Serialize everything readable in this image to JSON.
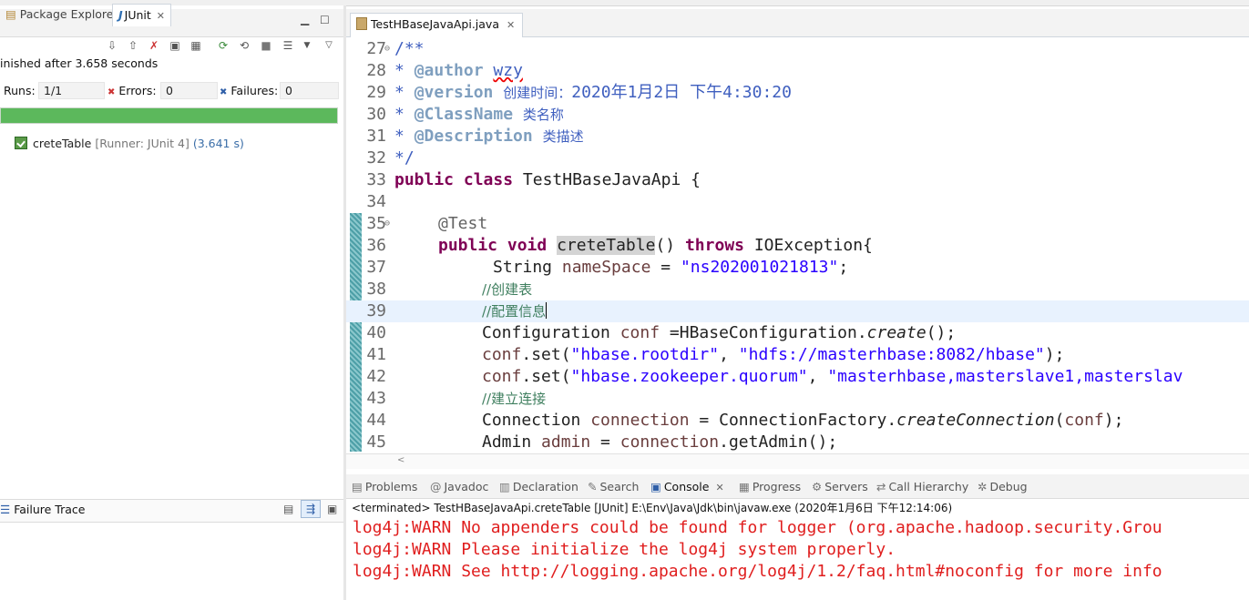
{
  "left_panel": {
    "tabs": [
      {
        "label": "Package Explorer"
      },
      {
        "label": "JUnit"
      }
    ],
    "status": "inished after 3.658 seconds",
    "runs_label": "Runs:",
    "runs_value": "1/1",
    "errors_label": "Errors:",
    "errors_value": "0",
    "failures_label": "Failures:",
    "failures_value": "0",
    "progress": 1.0,
    "progress_color": "#5cb85c",
    "test": {
      "name": "creteTable",
      "runner": "[Runner: JUnit 4]",
      "time": "(3.641 s)"
    },
    "failure_trace_label": "Failure Trace"
  },
  "editor": {
    "tab_label": "TestHBaseJavaApi.java",
    "line_numbers": [
      "27",
      "28",
      "29",
      "30",
      "31",
      "32",
      "33",
      "34",
      "35",
      "36",
      "37",
      "38",
      "39",
      "40",
      "41",
      "42",
      "43",
      "44",
      "45"
    ],
    "code": {
      "l27": "/**",
      "l28_star": "* ",
      "l28_tag": "@author",
      "l28_val": "wzy",
      "l29_star": "* ",
      "l29_tag": "@version",
      "l29_cjk": "创建时间：",
      "l29_val": "2020年1月2日 下午4:30:20",
      "l30_star": "* ",
      "l30_tag": "@ClassName",
      "l30_cjk": "类名称",
      "l31_star": "* ",
      "l31_tag": "@Description",
      "l31_cjk": "类描述",
      "l32": "*/",
      "l33_kw1": "public",
      "l33_kw2": "class",
      "l33_rest": "TestHBaseJavaApi {",
      "l35": "@Test",
      "l36_kw1": "public",
      "l36_kw2": "void",
      "l36_method": "creteTable",
      "l36_mid": "() ",
      "l36_kw3": "throws",
      "l36_rest": " IOException{",
      "l37_type": "String",
      "l37_var": "nameSpace",
      "l37_eq": " = ",
      "l37_str": "\"ns202001021813\"",
      "l37_end": ";",
      "l38": "//创建表",
      "l39": "//配置信息",
      "l40_a": "Configuration ",
      "l40_var": "conf",
      "l40_b": " =HBaseConfiguration.",
      "l40_static": "create",
      "l40_c": "();",
      "l41_var": "conf",
      "l41_a": ".set(",
      "l41_s1": "\"hbase.rootdir\"",
      "l41_b": ", ",
      "l41_s2": "\"hdfs://masterhbase:8082/hbase\"",
      "l41_c": ");",
      "l42_var": "conf",
      "l42_a": ".set(",
      "l42_s1": "\"hbase.zookeeper.quorum\"",
      "l42_b": ", ",
      "l42_s2": "\"masterhbase,masterslave1,masterslav",
      "l43": "//建立连接",
      "l44_a": "Connection ",
      "l44_var": "connection",
      "l44_b": " = ConnectionFactory.",
      "l44_static": "createConnection",
      "l44_c": "(",
      "l44_var2": "conf",
      "l44_d": ");",
      "l45_a": "Admin ",
      "l45_var": "admin",
      "l45_b": " = ",
      "l45_var2": "connection",
      "l45_c": ".getAdmin();"
    }
  },
  "bottom": {
    "tabs": [
      {
        "label": "Problems",
        "icon": "problems-icon"
      },
      {
        "label": "Javadoc",
        "icon": "javadoc-icon"
      },
      {
        "label": "Declaration",
        "icon": "declaration-icon"
      },
      {
        "label": "Search",
        "icon": "search-icon"
      },
      {
        "label": "Console",
        "icon": "console-icon"
      },
      {
        "label": "Progress",
        "icon": "progress-icon"
      },
      {
        "label": "Servers",
        "icon": "servers-icon"
      },
      {
        "label": "Call Hierarchy",
        "icon": "call-hierarchy-icon"
      },
      {
        "label": "Debug",
        "icon": "debug-icon"
      }
    ],
    "terminated": "<terminated> TestHBaseJavaApi.creteTable [JUnit] E:\\Env\\Java\\Jdk\\bin\\javaw.exe (2020年1月6日 下午12:14:06)",
    "console_lines": [
      "log4j:WARN No appenders could be found for logger (org.apache.hadoop.security.Grou",
      "log4j:WARN Please initialize the log4j system properly.",
      "log4j:WARN See http://logging.apache.org/log4j/1.2/faq.html#noconfig for more info"
    ],
    "console_color": "#e01e1e"
  }
}
